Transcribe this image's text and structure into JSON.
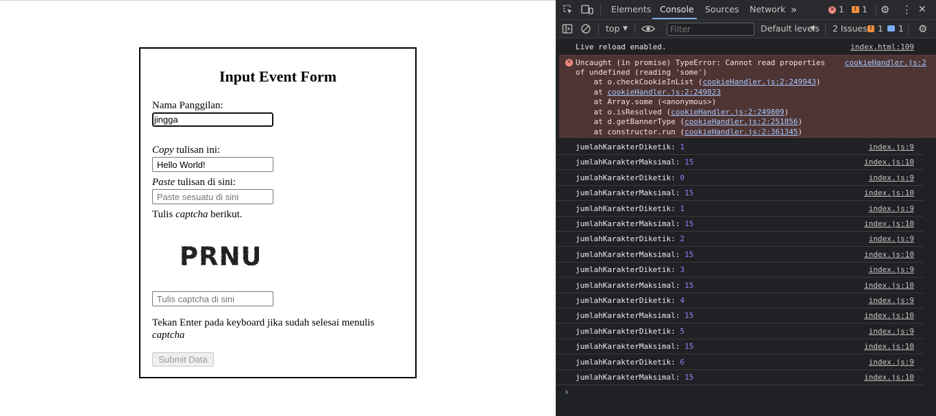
{
  "form": {
    "title": "Input Event Form",
    "nickname_label": "Nama Panggilan:",
    "nickname_value": "jingga",
    "copy_label_em": "Copy",
    "copy_label_rest": " tulisan ini:",
    "copy_value": "Hello World!",
    "paste_label_em": "Paste",
    "paste_label_rest": " tulisan di sini:",
    "paste_placeholder": "Paste sesuatu di sini",
    "captcha_label_pre": "Tulis ",
    "captcha_label_em": "captcha",
    "captcha_label_post": " berikut.",
    "captcha_image_text": "PRNU",
    "captcha_placeholder": "Tulis captcha di sini",
    "hint_text": "Tekan Enter pada keyboard jika sudah selesai menulis",
    "hint_em": "captcha",
    "submit_label": "Submit Data"
  },
  "devtools": {
    "tabs": [
      "Elements",
      "Console",
      "Sources",
      "Network"
    ],
    "active_tab": "Console",
    "error_count": "1",
    "warning_count": "1",
    "context": "top",
    "filter_placeholder": "Filter",
    "levels": "Default levels",
    "issues_label": "2 Issues:",
    "issues_warn": "1",
    "issues_info": "1",
    "colors": {
      "bg": "#202124",
      "error_bg": "#4e3534",
      "accent": "#7cacf8",
      "number": "#9980ff"
    },
    "live_reload": {
      "text": "Live reload enabled.",
      "src": "index.html:109"
    },
    "error": {
      "line1": "Uncaught (in promise) TypeError: Cannot read properties",
      "line2": "of undefined (reading 'some')",
      "src": "cookieHandler.js:2",
      "stack": [
        {
          "pre": "    at o.checkCookieInList (",
          "link": "cookieHandler.js:2:249943",
          "post": ")"
        },
        {
          "pre": "    at ",
          "link": "cookieHandler.js:2:249823",
          "post": ""
        },
        {
          "pre": "    at Array.some (<anonymous>)",
          "link": "",
          "post": ""
        },
        {
          "pre": "    at o.isResolved (",
          "link": "cookieHandler.js:2:249809",
          "post": ")"
        },
        {
          "pre": "    at d.getBannerType (",
          "link": "cookieHandler.js:2:251856",
          "post": ")"
        },
        {
          "pre": "    at constructor.run (",
          "link": "cookieHandler.js:2:361345",
          "post": ")"
        }
      ]
    },
    "logs": [
      {
        "label": "jumlahKarakterDiketik: ",
        "value": "1",
        "src": "index.js:9"
      },
      {
        "label": "jumlahKarakterMaksimal: ",
        "value": "15",
        "src": "index.js:10"
      },
      {
        "label": "jumlahKarakterDiketik: ",
        "value": "0",
        "src": "index.js:9"
      },
      {
        "label": "jumlahKarakterMaksimal: ",
        "value": "15",
        "src": "index.js:10"
      },
      {
        "label": "jumlahKarakterDiketik: ",
        "value": "1",
        "src": "index.js:9"
      },
      {
        "label": "jumlahKarakterMaksimal: ",
        "value": "15",
        "src": "index.js:10"
      },
      {
        "label": "jumlahKarakterDiketik: ",
        "value": "2",
        "src": "index.js:9"
      },
      {
        "label": "jumlahKarakterMaksimal: ",
        "value": "15",
        "src": "index.js:10"
      },
      {
        "label": "jumlahKarakterDiketik: ",
        "value": "3",
        "src": "index.js:9"
      },
      {
        "label": "jumlahKarakterMaksimal: ",
        "value": "15",
        "src": "index.js:10"
      },
      {
        "label": "jumlahKarakterDiketik: ",
        "value": "4",
        "src": "index.js:9"
      },
      {
        "label": "jumlahKarakterMaksimal: ",
        "value": "15",
        "src": "index.js:10"
      },
      {
        "label": "jumlahKarakterDiketik: ",
        "value": "5",
        "src": "index.js:9"
      },
      {
        "label": "jumlahKarakterMaksimal: ",
        "value": "15",
        "src": "index.js:10"
      },
      {
        "label": "jumlahKarakterDiketik: ",
        "value": "6",
        "src": "index.js:9"
      },
      {
        "label": "jumlahKarakterMaksimal: ",
        "value": "15",
        "src": "index.js:10"
      }
    ],
    "prompt": "›"
  }
}
